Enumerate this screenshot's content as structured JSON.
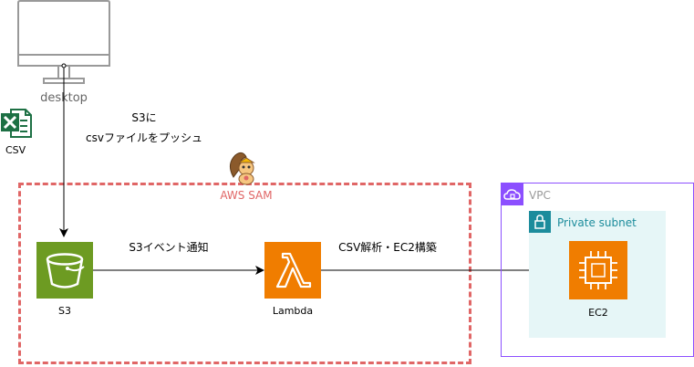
{
  "desktop": {
    "label": "desktop"
  },
  "csv_file": {
    "label": "CSV",
    "icon": "excel-icon"
  },
  "push_edge": {
    "line1": "S3に",
    "line2": "csvファイルをプッシュ"
  },
  "sam_group": {
    "label": "AWS SAM",
    "icon": "squirrel-mascot-icon",
    "border_color": "#e06666"
  },
  "s3": {
    "label": "S3",
    "icon": "bucket-icon",
    "color": "#6d9b22"
  },
  "lambda": {
    "label": "Lambda",
    "icon": "lambda-icon",
    "color": "#f07d00"
  },
  "ec2": {
    "label": "EC2",
    "icon": "chip-icon",
    "color": "#f07d00"
  },
  "s3_to_lambda": {
    "label": "S3イベント通知"
  },
  "lambda_to_ec2": {
    "label": "CSV解析・EC2構築"
  },
  "vpc": {
    "label": "VPC",
    "icon": "vpc-cloud-icon",
    "color": "#8c4fff"
  },
  "subnet": {
    "label": "Private subnet",
    "icon": "lock-icon",
    "color": "#1c8c9c",
    "fill": "#e6f6f7"
  }
}
